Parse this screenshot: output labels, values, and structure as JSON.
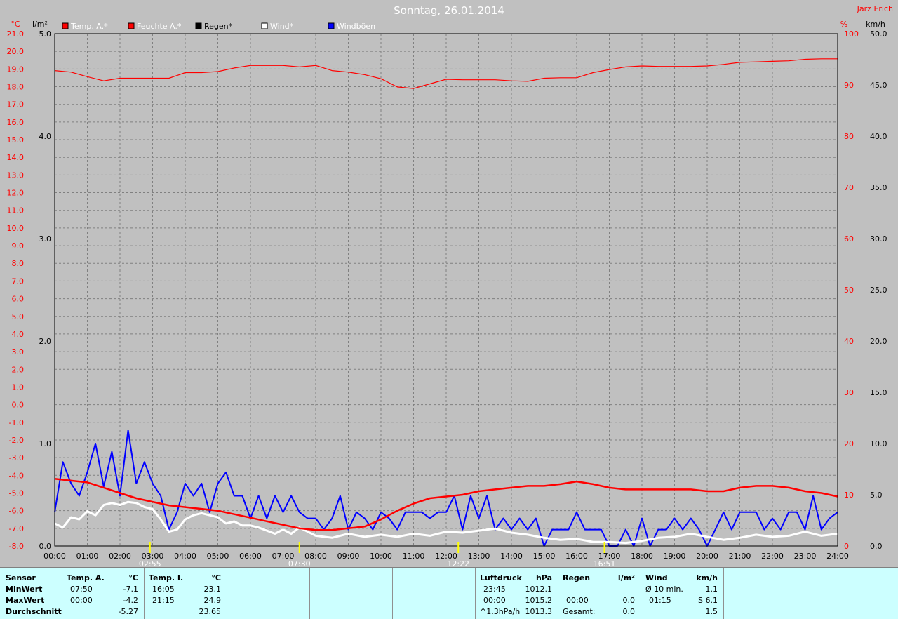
{
  "header": {
    "title": "Sonntag, 26.01.2014",
    "author": "Jarz Erich"
  },
  "legend": [
    {
      "label": "Temp. A.*",
      "color": "#ff0000"
    },
    {
      "label": "Feuchte A.*",
      "color": "#ff0000"
    },
    {
      "label": "Regen*",
      "color": "#000000"
    },
    {
      "label": "Wind*",
      "color": "#ffffff"
    },
    {
      "label": "Windböen",
      "color": "#0000ff"
    }
  ],
  "axes": {
    "temp_unit": "°C",
    "rain_unit": "l/m²",
    "hum_unit": "%",
    "wind_unit": "km/h",
    "temp_ticks": [
      "21.0",
      "20.0",
      "19.0",
      "18.0",
      "17.0",
      "16.0",
      "15.0",
      "14.0",
      "13.0",
      "12.0",
      "11.0",
      "10.0",
      "9.0",
      "8.0",
      "7.0",
      "6.0",
      "5.0",
      "4.0",
      "3.0",
      "2.0",
      "1.0",
      "0.0",
      "-1.0",
      "-2.0",
      "-3.0",
      "-4.0",
      "-5.0",
      "-6.0",
      "-7.0",
      "-8.0"
    ],
    "rain_ticks": [
      "5.0",
      "4.0",
      "3.0",
      "2.0",
      "1.0",
      "0.0"
    ],
    "hum_ticks": [
      "100",
      "90",
      "80",
      "70",
      "60",
      "50",
      "40",
      "30",
      "20",
      "10",
      "0"
    ],
    "wind_ticks": [
      "50.0",
      "45.0",
      "40.0",
      "35.0",
      "30.0",
      "25.0",
      "20.0",
      "15.0",
      "10.0",
      "5.0",
      "0.0"
    ],
    "time_ticks": [
      "00:00",
      "01:00",
      "02:00",
      "03:00",
      "04:00",
      "05:00",
      "06:00",
      "07:00",
      "08:00",
      "09:00",
      "10:00",
      "11:00",
      "12:00",
      "13:00",
      "14:00",
      "15:00",
      "16:00",
      "17:00",
      "18:00",
      "19:00",
      "20:00",
      "21:00",
      "22:00",
      "23:00",
      "24:00"
    ]
  },
  "markers": [
    {
      "label": "02:55",
      "hour": 2.92
    },
    {
      "label": "07:30",
      "hour": 7.5
    },
    {
      "label": "12:22",
      "hour": 12.37
    },
    {
      "label": "16:51",
      "hour": 16.85
    }
  ],
  "colors": {
    "temp": "#ff0000",
    "humidity": "#ff0000",
    "wind": "#ffffff",
    "gust": "#0000ff",
    "grid": "#808080",
    "plot_bg": "#c0c0c0",
    "stats_bg": "#ccffff"
  },
  "chart_data": {
    "type": "line",
    "xlim": [
      0,
      24
    ],
    "axes_ranges": {
      "temp": [
        -8,
        21
      ],
      "rain": [
        0,
        5
      ],
      "humidity": [
        0,
        100
      ],
      "wind": [
        0,
        50
      ]
    },
    "grid": true,
    "legend_position": "top",
    "series": [
      {
        "name": "Temp. A.*",
        "axis": "temp",
        "x": [
          0,
          0.5,
          1,
          1.5,
          2,
          2.5,
          3,
          3.5,
          4,
          4.5,
          5,
          5.5,
          6,
          6.5,
          7,
          7.5,
          8,
          8.5,
          9,
          9.5,
          10,
          10.5,
          11,
          11.5,
          12,
          12.5,
          13,
          13.5,
          14,
          14.5,
          15,
          15.5,
          16,
          16.5,
          17,
          17.5,
          18,
          18.5,
          19,
          19.5,
          20,
          20.5,
          21,
          21.5,
          22,
          22.5,
          23,
          23.5,
          24
        ],
        "y": [
          -4.2,
          -4.3,
          -4.4,
          -4.7,
          -5.0,
          -5.3,
          -5.5,
          -5.7,
          -5.8,
          -5.9,
          -6.0,
          -6.2,
          -6.4,
          -6.6,
          -6.8,
          -7.0,
          -7.1,
          -7.1,
          -7.0,
          -6.9,
          -6.5,
          -6.0,
          -5.6,
          -5.3,
          -5.2,
          -5.1,
          -4.9,
          -4.8,
          -4.7,
          -4.6,
          -4.6,
          -4.5,
          -4.35,
          -4.5,
          -4.7,
          -4.8,
          -4.8,
          -4.8,
          -4.8,
          -4.8,
          -4.9,
          -4.9,
          -4.7,
          -4.6,
          -4.6,
          -4.7,
          -4.9,
          -5.0,
          -5.2
        ]
      },
      {
        "name": "Feuchte A.*",
        "axis": "humidity",
        "x": [
          0,
          0.5,
          1,
          1.5,
          2,
          2.5,
          3,
          3.5,
          4,
          4.5,
          5,
          5.5,
          6,
          6.5,
          7,
          7.5,
          8,
          8.5,
          9,
          9.5,
          10,
          10.5,
          11,
          11.5,
          12,
          12.5,
          13,
          13.5,
          14,
          14.5,
          15,
          15.5,
          16,
          16.5,
          17,
          17.5,
          18,
          18.5,
          19,
          19.5,
          20,
          20.5,
          21,
          21.5,
          22,
          22.5,
          23,
          23.5,
          24
        ],
        "y": [
          92.8,
          92.5,
          91.6,
          90.8,
          91.3,
          91.3,
          91.3,
          91.3,
          92.4,
          92.4,
          92.6,
          93.3,
          93.8,
          93.8,
          93.8,
          93.5,
          93.8,
          92.8,
          92.5,
          92.0,
          91.2,
          89.6,
          89.3,
          90.2,
          91.1,
          91.0,
          91.0,
          91.0,
          90.8,
          90.7,
          91.3,
          91.4,
          91.4,
          92.4,
          93.0,
          93.5,
          93.7,
          93.6,
          93.6,
          93.6,
          93.7,
          94.0,
          94.4,
          94.5,
          94.6,
          94.7,
          95.0,
          95.1,
          95.1
        ]
      },
      {
        "name": "Wind*",
        "axis": "wind",
        "x": [
          0,
          0.25,
          0.5,
          0.75,
          1,
          1.25,
          1.5,
          1.75,
          2,
          2.25,
          2.5,
          2.75,
          3,
          3.25,
          3.5,
          3.75,
          4,
          4.25,
          4.5,
          4.75,
          5,
          5.25,
          5.5,
          5.75,
          6,
          6.25,
          6.5,
          6.75,
          7,
          7.25,
          7.5,
          7.75,
          8,
          8.5,
          9,
          9.5,
          10,
          10.5,
          11,
          11.5,
          12,
          12.5,
          13,
          13.5,
          14,
          14.5,
          15,
          15.5,
          16,
          16.5,
          17,
          17.5,
          18,
          18.5,
          19,
          19.5,
          20,
          20.5,
          21,
          21.5,
          22,
          22.5,
          23,
          23.5,
          24
        ],
        "y": [
          2.2,
          1.8,
          2.8,
          2.6,
          3.4,
          3.0,
          4.0,
          4.2,
          4.0,
          4.3,
          4.2,
          3.8,
          3.6,
          2.6,
          1.4,
          1.6,
          2.6,
          3.0,
          3.2,
          3.0,
          2.8,
          2.2,
          2.4,
          2.0,
          2.0,
          1.8,
          1.5,
          1.2,
          1.6,
          1.2,
          1.8,
          1.4,
          1.0,
          0.8,
          1.2,
          0.9,
          1.1,
          0.9,
          1.2,
          1.0,
          1.4,
          1.3,
          1.5,
          1.7,
          1.3,
          1.1,
          0.8,
          0.6,
          0.7,
          0.4,
          0.4,
          0.3,
          0.5,
          0.8,
          0.9,
          1.2,
          0.9,
          0.6,
          0.8,
          1.1,
          0.9,
          1.0,
          1.4,
          1.0,
          1.2
        ]
      },
      {
        "name": "Windböen",
        "axis": "wind",
        "x": [
          0,
          0.25,
          0.5,
          0.75,
          1,
          1.25,
          1.5,
          1.75,
          2,
          2.25,
          2.5,
          2.75,
          3,
          3.25,
          3.5,
          3.75,
          4,
          4.25,
          4.5,
          4.75,
          5,
          5.25,
          5.5,
          5.75,
          6,
          6.25,
          6.5,
          6.75,
          7,
          7.25,
          7.5,
          7.75,
          8,
          8.25,
          8.5,
          8.75,
          9,
          9.25,
          9.5,
          9.75,
          10,
          10.25,
          10.5,
          10.75,
          11,
          11.25,
          11.5,
          11.75,
          12,
          12.25,
          12.5,
          12.75,
          13,
          13.25,
          13.5,
          13.75,
          14,
          14.25,
          14.5,
          14.75,
          15,
          15.25,
          15.5,
          15.75,
          16,
          16.25,
          16.5,
          16.75,
          17,
          17.25,
          17.5,
          17.75,
          18,
          18.25,
          18.5,
          18.75,
          19,
          19.25,
          19.5,
          19.75,
          20,
          20.25,
          20.5,
          20.75,
          21,
          21.25,
          21.5,
          21.75,
          22,
          22.25,
          22.5,
          22.75,
          23,
          23.25,
          23.5,
          23.75,
          24
        ],
        "y": [
          3.3,
          8.2,
          6.1,
          4.9,
          7.2,
          10.0,
          5.8,
          9.2,
          4.9,
          11.3,
          6.1,
          8.2,
          6.1,
          4.9,
          1.6,
          3.3,
          6.1,
          4.9,
          6.1,
          3.3,
          6.1,
          7.2,
          4.9,
          4.9,
          2.7,
          4.9,
          2.7,
          4.9,
          3.3,
          4.9,
          3.3,
          2.7,
          2.7,
          1.6,
          2.7,
          4.9,
          1.6,
          3.3,
          2.7,
          1.6,
          3.3,
          2.7,
          1.6,
          3.3,
          3.3,
          3.3,
          2.7,
          3.3,
          3.3,
          4.9,
          1.6,
          4.9,
          2.7,
          4.9,
          1.6,
          2.7,
          1.6,
          2.7,
          1.6,
          2.7,
          0.0,
          1.6,
          1.6,
          1.6,
          3.3,
          1.6,
          1.6,
          1.6,
          0.0,
          0.0,
          1.6,
          0.0,
          2.7,
          0.0,
          1.6,
          1.6,
          2.7,
          1.6,
          2.7,
          1.6,
          0.0,
          1.6,
          3.3,
          1.6,
          3.3,
          3.3,
          3.3,
          1.6,
          2.7,
          1.6,
          3.3,
          3.3,
          1.6,
          4.9,
          1.6,
          2.7,
          3.3
        ]
      },
      {
        "name": "Regen*",
        "axis": "rain",
        "x": [
          0,
          24
        ],
        "y": [
          0,
          0
        ]
      }
    ]
  },
  "stats": {
    "row_labels": {
      "sensor": "Sensor",
      "min": "MinWert",
      "max": "MaxWert",
      "avg": "Durchschnitt"
    },
    "temp_a": {
      "header": "Temp. A.",
      "unit": "°C",
      "min_time": "07:50",
      "min_val": "-7.1",
      "max_time": "00:00",
      "max_val": "-4.2",
      "avg_val": "-5.27"
    },
    "temp_i": {
      "header": "Temp. I.",
      "unit": "°C",
      "min_time": "16:05",
      "min_val": "23.1",
      "max_time": "21:15",
      "max_val": "24.9",
      "avg_val": "23.65"
    },
    "pressure": {
      "header": "Luftdruck",
      "unit": "hPa",
      "r1_time": "23:45",
      "r1_val": "1012.1",
      "r2_time": "00:00",
      "r2_val": "1015.2",
      "r3_label": "^1.3hPa/h",
      "r3_val": "1013.3"
    },
    "rain": {
      "header": "Regen",
      "unit": "l/m²",
      "r2_time": "00:00",
      "r2_val": "0.0",
      "r3_label": "Gesamt:",
      "r3_val": "0.0"
    },
    "wind": {
      "header": "Wind",
      "unit": "km/h",
      "r1_label": "Ø 10 min.",
      "r1_val": "1.1",
      "r2_time": "01:15",
      "r2_val": "S 6.1",
      "r3_val": "1.5"
    }
  }
}
